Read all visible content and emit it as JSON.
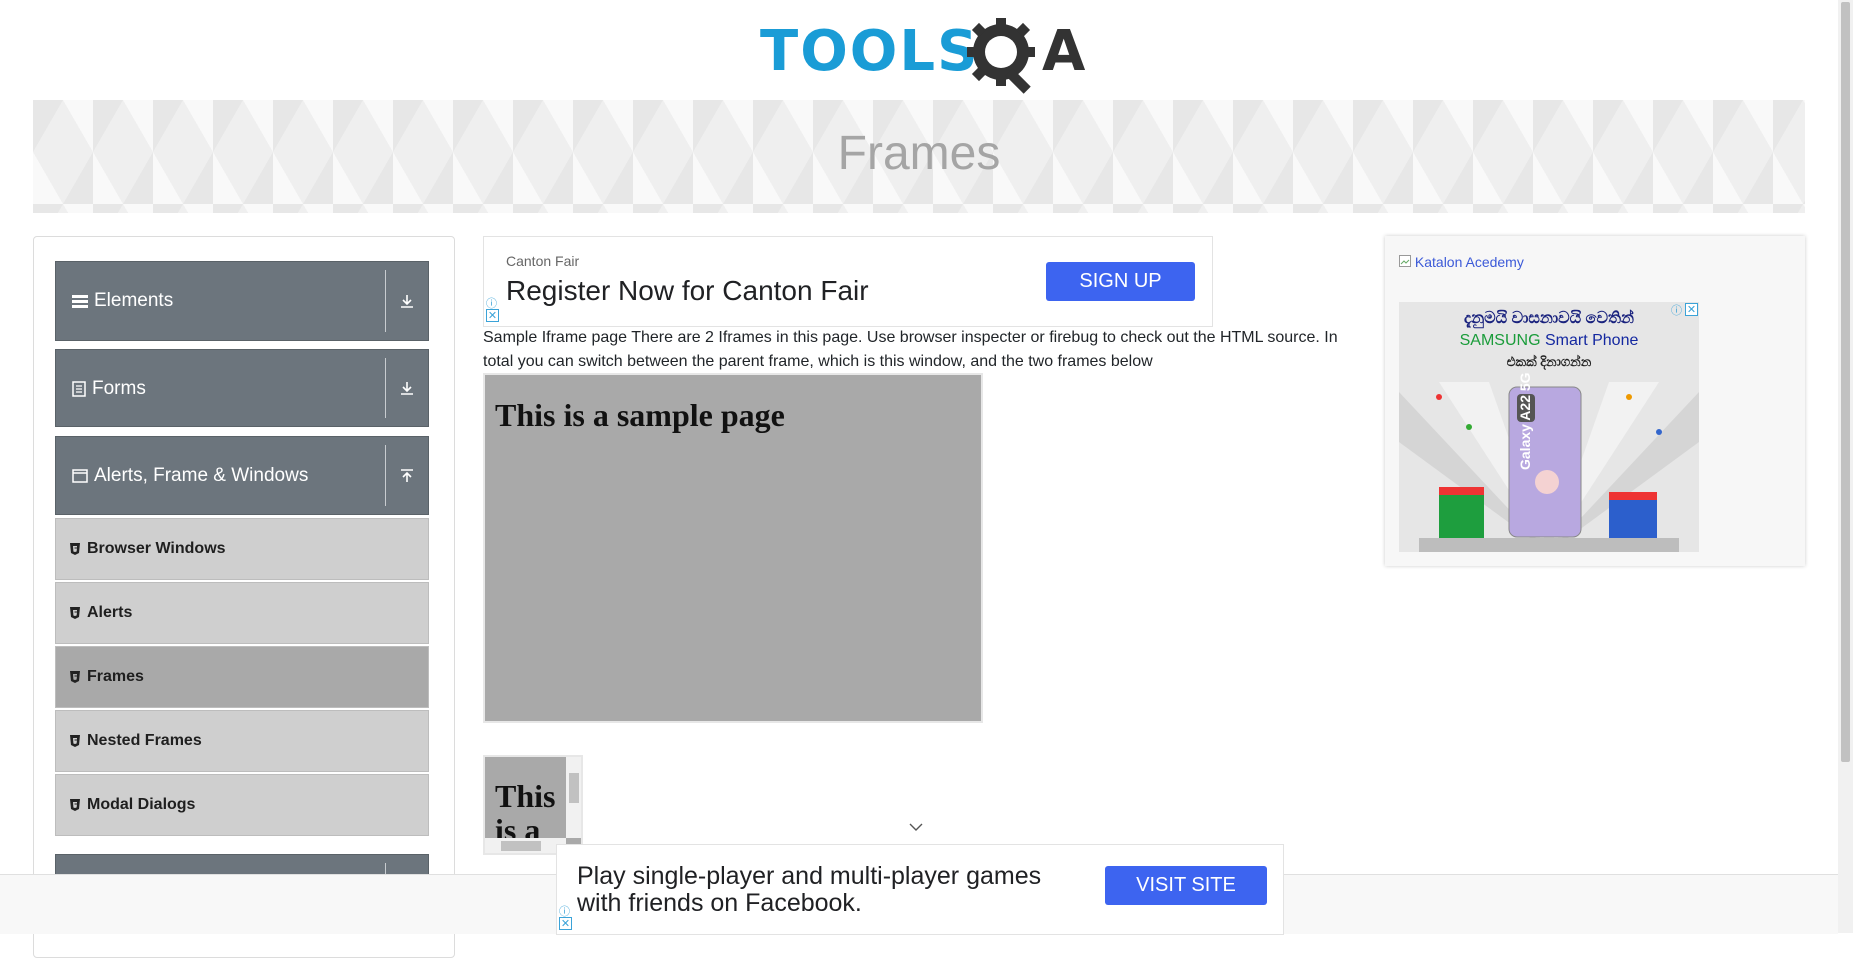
{
  "logo": {
    "main": "TOOLS",
    "tail": "A"
  },
  "banner": {
    "title": "Frames"
  },
  "sidebar": {
    "groups": [
      {
        "label": "Elements",
        "icon": "hamburger-icon",
        "arrow": "download"
      },
      {
        "label": "Forms",
        "icon": "document-icon",
        "arrow": "download"
      },
      {
        "label": "Alerts, Frame & Windows",
        "icon": "window-icon",
        "arrow": "upload"
      }
    ],
    "items": [
      {
        "label": "Browser Windows"
      },
      {
        "label": "Alerts"
      },
      {
        "label": "Frames"
      },
      {
        "label": "Nested Frames"
      },
      {
        "label": "Modal Dialogs"
      }
    ]
  },
  "ad_top": {
    "advertiser": "Canton Fair",
    "headline": "Register Now for Canton Fair",
    "cta": "SIGN UP"
  },
  "description": "Sample Iframe page There are 2 Iframes in this page. Use browser inspecter or firebug to check out the HTML source. In total you can switch between the parent frame, which is this window, and the two frames below",
  "frame1": {
    "heading": "This is a sample page"
  },
  "frame2": {
    "heading": "This is a"
  },
  "right_ad": {
    "link": "Katalon Acedemy",
    "line1": "දැනුමයි වාසනාවයි වෙතින්",
    "line2_brand": "SAMSUNG",
    "line2_rest": " Smart Phone",
    "line3": "එකක් දිනාගන්න",
    "phone": "Galaxy A22 5G"
  },
  "ad_bottom": {
    "headline": "Play single-player and multi-player games with friends on Facebook.",
    "cta": "VISIT SITE"
  },
  "colors": {
    "accent": "#3d64f0",
    "sidebar_group": "#6c757d",
    "frame_bg": "#a9a9a9",
    "logo_blue": "#1a9cd6"
  }
}
